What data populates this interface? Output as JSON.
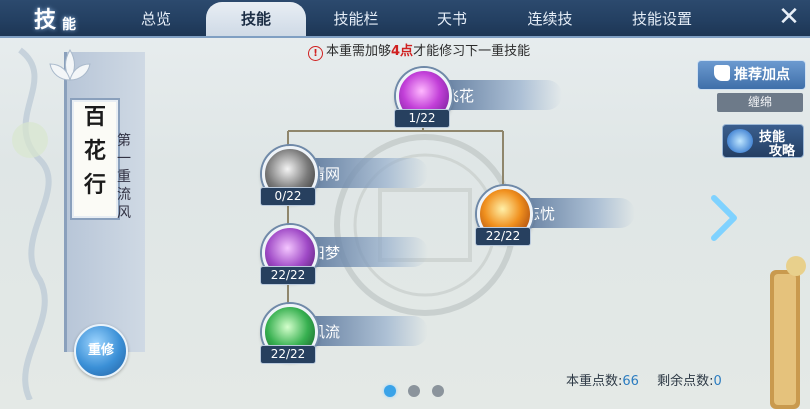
{
  "header": {
    "logo": [
      "技",
      "能"
    ],
    "tabs": [
      {
        "label": "总览",
        "active": false
      },
      {
        "label": "技能",
        "active": true
      },
      {
        "label": "技能栏",
        "active": false
      },
      {
        "label": "天书",
        "active": false
      },
      {
        "label": "连续技",
        "active": false
      },
      {
        "label": "技能设置",
        "active": false
      }
    ],
    "close_icon": "close-icon"
  },
  "warning": {
    "prefix": "本重需加够",
    "points": "4点",
    "suffix": "才能修习下一重技能"
  },
  "school": {
    "title_chars": [
      "百",
      "花",
      "行"
    ],
    "stage": "第一重流风",
    "reset_label": "重修"
  },
  "skills": {
    "feihua": {
      "name": "飞花",
      "level": "1/22",
      "icon": "purple-flower-icon"
    },
    "qingwang": {
      "name": "情网",
      "level": "0/22",
      "icon": "gray-swirl-icon"
    },
    "jiumeng": {
      "name": "旧梦",
      "level": "22/22",
      "icon": "purple-mask-icon"
    },
    "fengliu": {
      "name": "风流",
      "level": "22/22",
      "icon": "green-figure-icon"
    },
    "wangyou": {
      "name": "忘忧",
      "level": "22/22",
      "icon": "flame-icon"
    }
  },
  "right": {
    "recommend_label": "推荐加点",
    "plan_label": "缠绵",
    "guide_label_1": "技能",
    "guide_label_2": "攻略"
  },
  "pager": {
    "current": 1,
    "total": 3
  },
  "points": {
    "used_label": "本重点数:",
    "used": "66",
    "remain_label": "剩余点数:",
    "remain": "0"
  },
  "colors": {
    "accent": "#2c4a6e",
    "warn": "#d02020",
    "points": "#2b7cc0"
  }
}
